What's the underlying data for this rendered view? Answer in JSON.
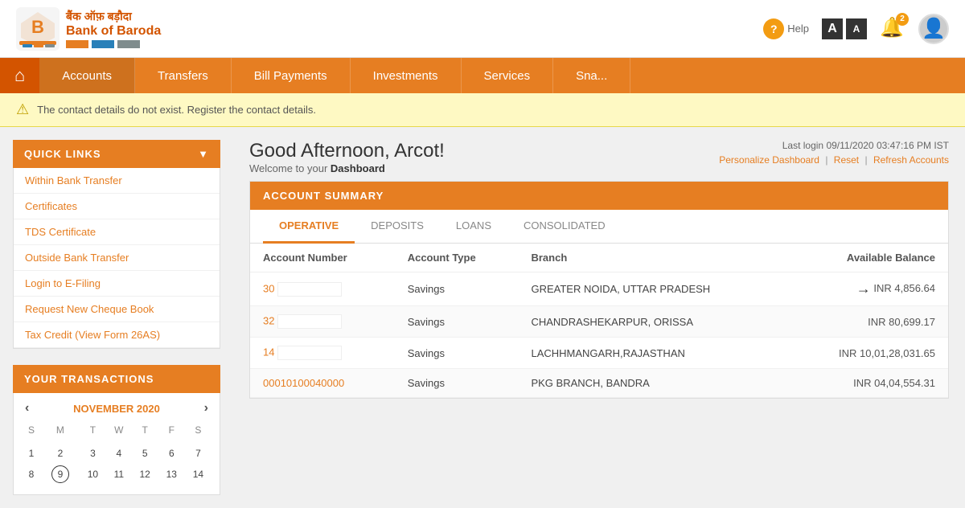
{
  "header": {
    "logo_hindi": "बैंक ऑफ़ बड़ौदा",
    "logo_english": "Bank of Baroda",
    "help_label": "Help",
    "notification_count": "2",
    "font_a_large": "A",
    "font_a_small": "A"
  },
  "nav": {
    "home_title": "Home",
    "items": [
      {
        "label": "Accounts",
        "active": true
      },
      {
        "label": "Transfers"
      },
      {
        "label": "Bill Payments"
      },
      {
        "label": "Investments"
      },
      {
        "label": "Services"
      },
      {
        "label": "Sna..."
      }
    ]
  },
  "alert": {
    "message": "The contact details do not exist. Register the contact details."
  },
  "sidebar": {
    "quick_links_title": "QUICK LINKS",
    "quick_links_items": [
      "Within Bank Transfer",
      "Certificates",
      "TDS Certificate",
      "Outside Bank Transfer",
      "Login to E-Filing",
      "Request New Cheque Book",
      "Tax Credit (View Form 26AS)"
    ],
    "transactions_title": "YOUR TRANSACTIONS",
    "calendar": {
      "month": "NOVEMBER 2020",
      "day_headers": [
        "S",
        "M",
        "T",
        "W",
        "T",
        "F",
        "S"
      ],
      "weeks": [
        [
          null,
          null,
          null,
          null,
          null,
          null,
          null
        ],
        [
          1,
          2,
          3,
          4,
          5,
          6,
          7
        ],
        [
          8,
          9,
          10,
          11,
          12,
          13,
          14
        ]
      ],
      "today": 9
    }
  },
  "dashboard": {
    "greeting": "Good Afternoon, Arcot!",
    "welcome": "Welcome to your ",
    "welcome_bold": "Dashboard",
    "last_login_label": "Last login",
    "last_login_value": "09/11/2020 03:47:16 PM IST",
    "personalize_label": "Personalize Dashboard",
    "reset_label": "Reset",
    "refresh_label": "Refresh Accounts",
    "account_summary_title": "ACCOUNT SUMMARY",
    "tabs": [
      {
        "label": "OPERATIVE",
        "active": true
      },
      {
        "label": "DEPOSITS"
      },
      {
        "label": "LOANS"
      },
      {
        "label": "CONSOLIDATED"
      }
    ],
    "table_headers": [
      "Account Number",
      "Account Type",
      "Branch",
      "Available Balance"
    ],
    "accounts": [
      {
        "account_num": "30...",
        "type": "Savings",
        "branch": "GREATER NOIDA, UTTAR PRADESH",
        "balance": "INR  4,856.64",
        "highlight_arrow": true
      },
      {
        "account_num": "32...",
        "type": "Savings",
        "branch": "CHANDRASHEKARPUR, ORISSA",
        "balance": "INR  80,699.17",
        "highlight_arrow": false
      },
      {
        "account_num": "14...",
        "type": "Savings",
        "branch": "LACHHMANGARH,RAJASTHAN",
        "balance": "INR  10,01,28,031.65",
        "highlight_arrow": false
      },
      {
        "account_num": "00010100040000",
        "type": "Savings",
        "branch": "PKG BRANCH, BANDRA",
        "balance": "INR  04,04,554.31",
        "highlight_arrow": false
      }
    ]
  }
}
